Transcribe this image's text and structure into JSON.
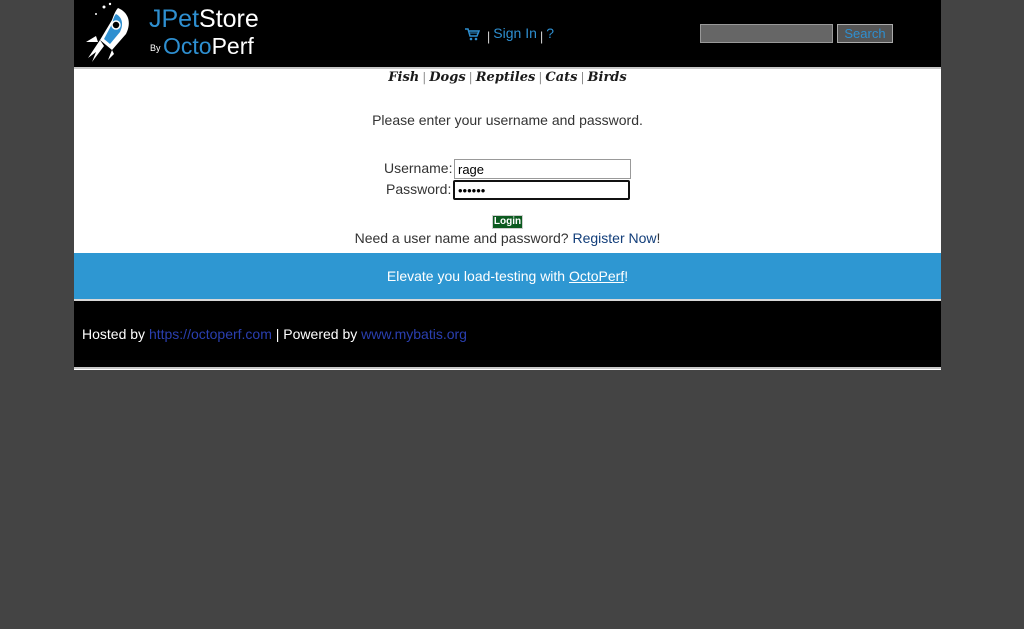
{
  "header": {
    "logo_part1": "JPet",
    "logo_part2": "Store",
    "logo_by": "By",
    "logo_part3": "Octo",
    "logo_part4": "Perf",
    "sign_in": "Sign In",
    "help": "?",
    "separator": "|",
    "search_value": "",
    "search_button": "Search"
  },
  "quicklinks": [
    "Fish",
    "Dogs",
    "Reptiles",
    "Cats",
    "Birds"
  ],
  "login": {
    "prompt": "Please enter your username and password.",
    "username_label": "Username:",
    "username_value": "rage",
    "password_label": "Password:",
    "password_value": "••••••",
    "login_button": "Login",
    "need_text": "Need a user name and password?",
    "register_link": "Register Now",
    "need_suffix": "!"
  },
  "banner": {
    "text": "Elevate you load-testing with",
    "link": "OctoPerf",
    "suffix": "!"
  },
  "footer": {
    "hosted_by": "Hosted by",
    "hosted_link": "https://octoperf.com",
    "powered_sep": "| Powered by",
    "powered_link": "www.mybatis.org"
  },
  "colors": {
    "page_bg": "#444444",
    "header_bg": "#000000",
    "accent": "#2e8fd0",
    "banner_bg": "#2e97d2",
    "login_button_bg": "#0b5a1f"
  },
  "icons": {
    "logo": "rocket-logo-icon",
    "cart": "cart-icon"
  }
}
